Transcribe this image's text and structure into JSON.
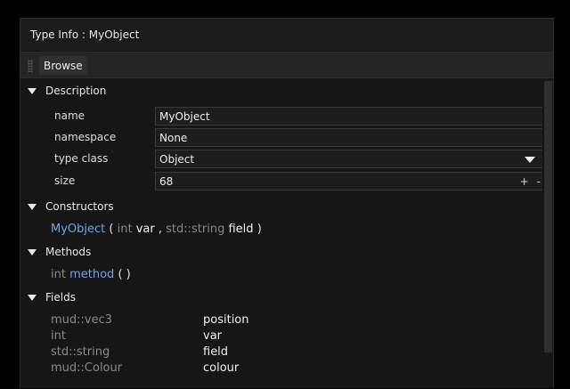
{
  "window": {
    "title": "Type Info : MyObject"
  },
  "toolbar": {
    "browse_label": "Browse"
  },
  "description": {
    "header": "Description",
    "rows": {
      "name": {
        "label": "name",
        "value": "MyObject"
      },
      "namespace": {
        "label": "namespace",
        "value": "None"
      },
      "type_class": {
        "label": "type class",
        "value": "Object"
      },
      "size": {
        "label": "size",
        "value": "68",
        "plus": "+",
        "minus": "-"
      }
    }
  },
  "constructors": {
    "header": "Constructors",
    "items": [
      {
        "name": "MyObject",
        "open": "(",
        "p1_type": "int",
        "p1_name": "var",
        "sep": ",",
        "p2_type": "std::string",
        "p2_name": "field",
        "close": ")"
      }
    ]
  },
  "methods": {
    "header": "Methods",
    "items": [
      {
        "return_type": "int",
        "name": "method",
        "open": "(",
        "close": ")"
      }
    ]
  },
  "fields": {
    "header": "Fields",
    "items": [
      {
        "type": "mud::vec3",
        "name": "position"
      },
      {
        "type": "int",
        "name": "var"
      },
      {
        "type": "std::string",
        "name": "field"
      },
      {
        "type": "mud::Colour",
        "name": "colour"
      }
    ]
  },
  "colors": {
    "type_link": "#6aa6e8",
    "panel": "#161616",
    "field_bg": "#1d1d1d"
  }
}
